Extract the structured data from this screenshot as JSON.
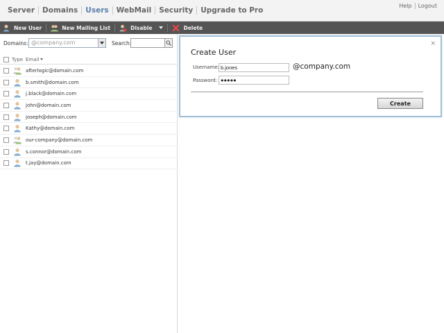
{
  "nav": {
    "items": [
      {
        "label": "Server",
        "active": false
      },
      {
        "label": "Domains",
        "active": false
      },
      {
        "label": "Users",
        "active": true
      },
      {
        "label": "WebMail",
        "active": false
      },
      {
        "label": "Security",
        "active": false
      },
      {
        "label": "Upgrade to Pro",
        "active": false
      }
    ],
    "help": "Help",
    "logout": "Logout"
  },
  "toolbar": {
    "new_user": "New User",
    "new_mailing_list": "New Mailing List",
    "disable": "Disable",
    "delete": "Delete"
  },
  "filter": {
    "domains_label": "Domains:",
    "domain_value": "@company.com",
    "search_label": "Search:",
    "search_value": ""
  },
  "list": {
    "col_type": "Type",
    "col_email": "Email",
    "rows": [
      {
        "email": "afterlogic@domain.com",
        "type": "mailing-list"
      },
      {
        "email": "b.smith@domain.com",
        "type": "user"
      },
      {
        "email": "j.black@domain.com",
        "type": "user"
      },
      {
        "email": "john@domain.com",
        "type": "user"
      },
      {
        "email": "joseph@domain.com",
        "type": "user"
      },
      {
        "email": "Kathy@domain.com",
        "type": "user"
      },
      {
        "email": "our-company@domain.com",
        "type": "mailing-list"
      },
      {
        "email": "s.connor@domain.com",
        "type": "user"
      },
      {
        "email": "t.jay@domain.com",
        "type": "user"
      }
    ]
  },
  "dialog": {
    "title": "Create User",
    "close": "×",
    "username_label": "Username:",
    "username_value": "b.jones",
    "domain_suffix": "@company.com",
    "password_label": "Password:",
    "password_value": "●●●●●",
    "create_button": "Create"
  },
  "colors": {
    "toolbar_bg": "#545454",
    "nav_active": "#5a7fa8",
    "dialog_border": "#9fc0d8"
  }
}
